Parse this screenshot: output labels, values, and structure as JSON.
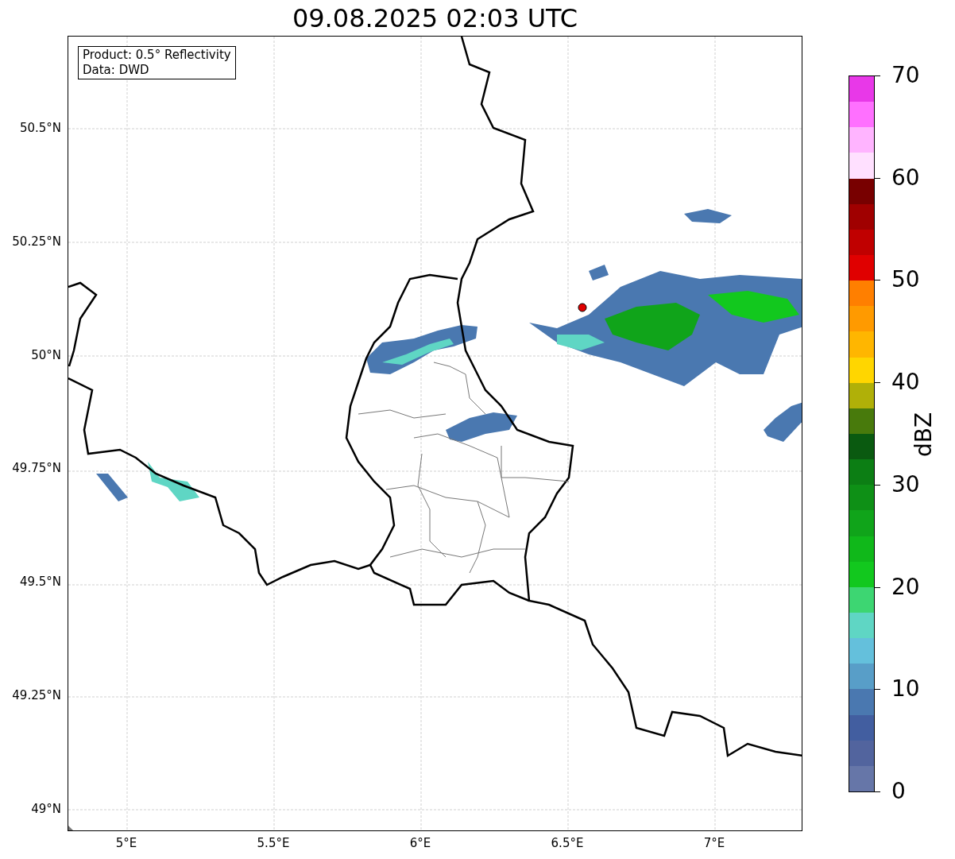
{
  "title": "09.08.2025 02:03 UTC",
  "info_box": [
    "Product: 0.5° Reflectivity",
    "Data: DWD"
  ],
  "map": {
    "x_ticks": [
      "5°E",
      "5.5°E",
      "6°E",
      "6.5°E",
      "7°E"
    ],
    "y_ticks": [
      "50.5°N",
      "50.25°N",
      "50°N",
      "49.75°N",
      "49.5°N",
      "49.25°N",
      "49°N"
    ]
  },
  "colorbar": {
    "label": "dBZ",
    "ticks": [
      "70",
      "60",
      "50",
      "40",
      "30",
      "20",
      "10",
      "0"
    ],
    "bins": [
      {
        "color": "#e838e8"
      },
      {
        "color": "#ff70ff"
      },
      {
        "color": "#ffb4ff"
      },
      {
        "color": "#ffe0ff"
      },
      {
        "color": "#780000"
      },
      {
        "color": "#a00000"
      },
      {
        "color": "#c00000"
      },
      {
        "color": "#e00000"
      },
      {
        "color": "#ff7f00"
      },
      {
        "color": "#ff9a00"
      },
      {
        "color": "#ffb600"
      },
      {
        "color": "#ffd600"
      },
      {
        "color": "#b0b008"
      },
      {
        "color": "#487a0c"
      },
      {
        "color": "#0a5a10"
      },
      {
        "color": "#0c7e14"
      },
      {
        "color": "#0e9016"
      },
      {
        "color": "#10a41a"
      },
      {
        "color": "#10b81a"
      },
      {
        "color": "#12c81e"
      },
      {
        "color": "#3dd672"
      },
      {
        "color": "#5fd6c4"
      },
      {
        "color": "#64c0dc"
      },
      {
        "color": "#589ec8"
      },
      {
        "color": "#4a78b0"
      },
      {
        "color": "#425ea0"
      },
      {
        "color": "#52649e"
      },
      {
        "color": "#6676a8"
      }
    ]
  }
}
